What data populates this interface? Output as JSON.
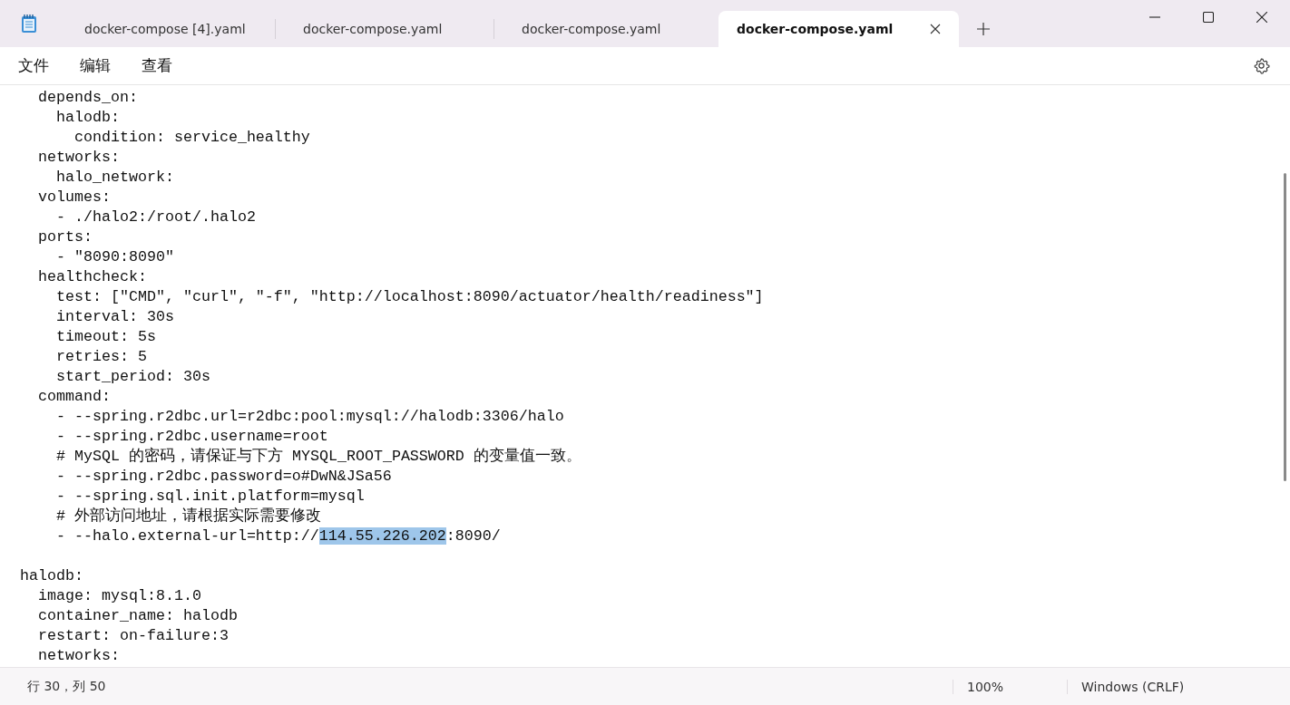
{
  "tabs": [
    {
      "label": "docker-compose [4].yaml",
      "selected": false
    },
    {
      "label": "docker-compose.yaml",
      "selected": false
    },
    {
      "label": "docker-compose.yaml",
      "selected": false
    },
    {
      "label": "docker-compose.yaml",
      "selected": true
    }
  ],
  "menu": [
    "文件",
    "编辑",
    "查看"
  ],
  "lines": [
    {
      "text": "    depends_on:"
    },
    {
      "text": "      halodb:"
    },
    {
      "text": "        condition: service_healthy"
    },
    {
      "text": "    networks:"
    },
    {
      "text": "      halo_network:"
    },
    {
      "text": "    volumes:"
    },
    {
      "text": "      - ./halo2:/root/.halo2"
    },
    {
      "text": "    ports:"
    },
    {
      "text": "      - \"8090:8090\""
    },
    {
      "text": "    healthcheck:"
    },
    {
      "text": "      test: [\"CMD\", \"curl\", \"-f\", \"http://localhost:8090/actuator/health/readiness\"]"
    },
    {
      "text": "      interval: 30s"
    },
    {
      "text": "      timeout: 5s"
    },
    {
      "text": "      retries: 5"
    },
    {
      "text": "      start_period: 30s"
    },
    {
      "text": "    command:"
    },
    {
      "text": "      - --spring.r2dbc.url=r2dbc:pool:mysql://halodb:3306/halo"
    },
    {
      "text": "      - --spring.r2dbc.username=root"
    },
    {
      "text": "      # MySQL 的密码，请保证与下方 MYSQL_ROOT_PASSWORD 的变量值一致。"
    },
    {
      "text": "      - --spring.r2dbc.password=o#DwN&JSa56"
    },
    {
      "text": "      - --spring.sql.init.platform=mysql"
    },
    {
      "text": "      # 外部访问地址，请根据实际需要修改"
    },
    {
      "text": "      - --halo.external-url=http://",
      "selection": "114.55.226.202",
      "after": ":8090/"
    },
    {
      "text": "  halodb:",
      "gap_before": true
    },
    {
      "text": "    image: mysql:8.1.0"
    },
    {
      "text": "    container_name: halodb"
    },
    {
      "text": "    restart: on-failure:3"
    },
    {
      "text": "    networks:"
    }
  ],
  "status_bar": {
    "position": "行 30，列 50",
    "zoom": "100%",
    "line_ending": "Windows (CRLF)"
  }
}
